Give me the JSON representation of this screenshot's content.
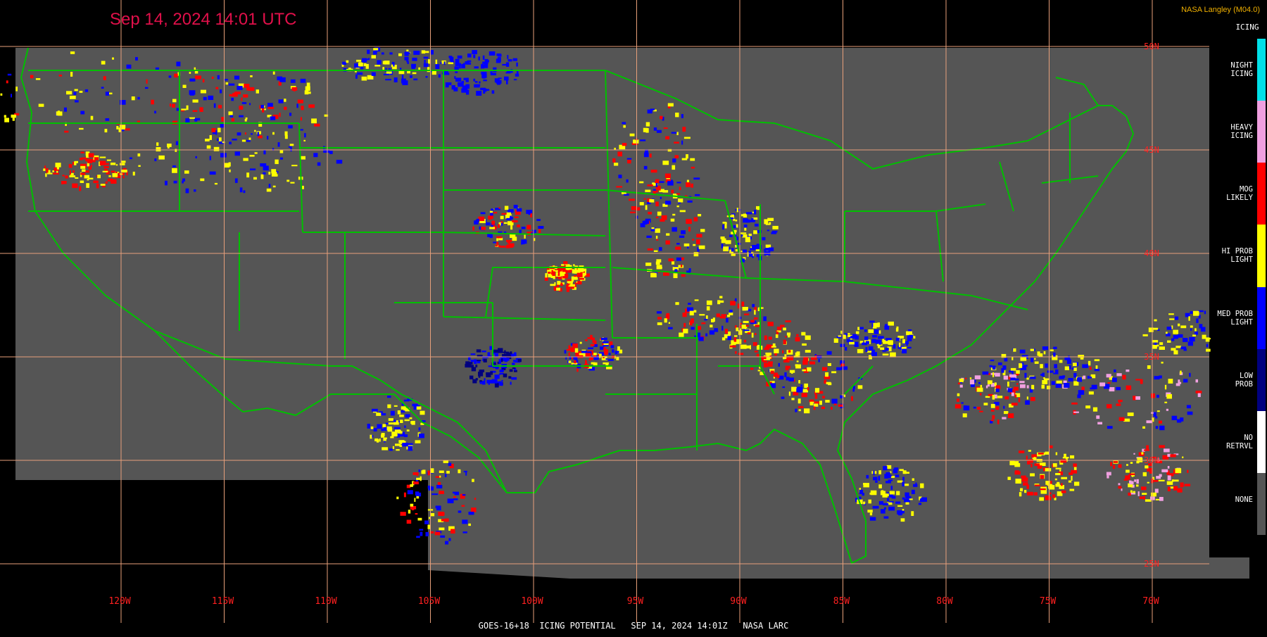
{
  "header": {
    "timestamp": "Sep 14, 2024 14:01 UTC",
    "credit": "NASA Langley (M04.0)"
  },
  "footer": {
    "caption": "GOES-16+18  ICING POTENTIAL   SEP 14, 2024 14:01Z   NASA LARC"
  },
  "legend": {
    "title": "ICING",
    "items": [
      {
        "label": "NIGHT\nICING",
        "color": "#00e0e8"
      },
      {
        "label": "HEAVY\nICING",
        "color": "#f0a0e0"
      },
      {
        "label": "MOG\nLIKELY",
        "color": "#ff0000"
      },
      {
        "label": "HI PROB\nLIGHT",
        "color": "#ffff00"
      },
      {
        "label": "MED PROB\nLIGHT",
        "color": "#0000ff"
      },
      {
        "label": "LOW\nPROB",
        "color": "#000080"
      },
      {
        "label": "NO\nRETRVL",
        "color": "#ffffff"
      },
      {
        "label": "NONE",
        "color": "#555555"
      }
    ]
  },
  "grid": {
    "longitudes": [
      {
        "lon": -120,
        "label": "120W"
      },
      {
        "lon": -115,
        "label": "115W"
      },
      {
        "lon": -110,
        "label": "110W"
      },
      {
        "lon": -105,
        "label": "105W"
      },
      {
        "lon": -100,
        "label": "100W"
      },
      {
        "lon": -95,
        "label": "95W"
      },
      {
        "lon": -90,
        "label": "90W"
      },
      {
        "lon": -85,
        "label": "85W"
      },
      {
        "lon": -80,
        "label": "80W"
      },
      {
        "lon": -75,
        "label": "75W"
      },
      {
        "lon": -70,
        "label": "70W"
      }
    ],
    "latitudes": [
      {
        "lat": 50,
        "label": "50N"
      },
      {
        "lat": 45,
        "label": "45N"
      },
      {
        "lat": 40,
        "label": "40N"
      },
      {
        "lat": 35,
        "label": "35N"
      },
      {
        "lat": 30,
        "label": "30N"
      },
      {
        "lat": 25,
        "label": "25N"
      }
    ],
    "line_color": "#e8a07a",
    "label_color": "#ff2020"
  },
  "colors": {
    "background": "#000000",
    "no_data_area": "#555555",
    "boundaries": "#00c000"
  }
}
